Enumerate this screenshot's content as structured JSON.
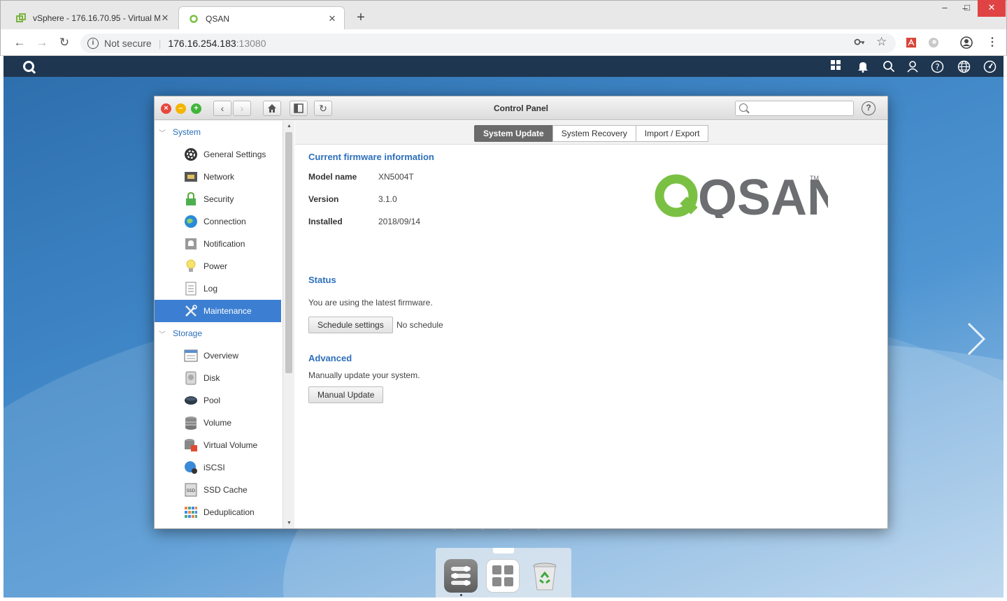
{
  "browser": {
    "tabs": [
      {
        "title": "vSphere - 176.16.70.95 - Virtual M",
        "active": false
      },
      {
        "title": "QSAN",
        "active": true
      }
    ],
    "new_tab": "+",
    "window_controls": {
      "minimize": "–",
      "maximize": "□",
      "close": "✕"
    },
    "address": {
      "security_label": "Not secure",
      "host": "176.16.254.183",
      "port": ":13080"
    },
    "icons": [
      "back-icon",
      "forward-icon",
      "reload-icon",
      "info-icon",
      "key-icon",
      "star-icon",
      "pdf-extension-icon",
      "extension-icon",
      "profile-icon",
      "menu-icon"
    ]
  },
  "topbar": {
    "icons": [
      "qsan-logo-icon",
      "apps-grid-icon",
      "bell-icon",
      "search-icon",
      "user-icon",
      "help-icon",
      "globe-icon",
      "dashboard-icon"
    ],
    "bg_color": "#1f3650"
  },
  "control_panel": {
    "title": "Control Panel",
    "search_placeholder": "",
    "help": "?",
    "sidebar": {
      "groups": [
        {
          "label": "System",
          "items": [
            {
              "label": "General Settings",
              "icon": "general-settings-icon"
            },
            {
              "label": "Network",
              "icon": "network-icon"
            },
            {
              "label": "Security",
              "icon": "lock-icon"
            },
            {
              "label": "Connection",
              "icon": "connection-globe-icon"
            },
            {
              "label": "Notification",
              "icon": "notification-bell-icon"
            },
            {
              "label": "Power",
              "icon": "lightbulb-icon"
            },
            {
              "label": "Log",
              "icon": "log-icon"
            },
            {
              "label": "Maintenance",
              "icon": "tools-icon",
              "selected": true
            }
          ]
        },
        {
          "label": "Storage",
          "items": [
            {
              "label": "Overview",
              "icon": "overview-icon"
            },
            {
              "label": "Disk",
              "icon": "disk-icon"
            },
            {
              "label": "Pool",
              "icon": "pool-icon"
            },
            {
              "label": "Volume",
              "icon": "volume-icon"
            },
            {
              "label": "Virtual Volume",
              "icon": "virtual-volume-icon"
            },
            {
              "label": "iSCSI",
              "icon": "iscsi-icon"
            },
            {
              "label": "SSD Cache",
              "icon": "ssd-icon"
            },
            {
              "label": "Deduplication",
              "icon": "deduplication-icon"
            }
          ]
        }
      ]
    },
    "tabs": [
      "System Update",
      "System Recovery",
      "Import / Export"
    ],
    "active_tab": "System Update",
    "firmware": {
      "section_title": "Current firmware information",
      "rows": [
        {
          "label": "Model name",
          "value": "XN5004T"
        },
        {
          "label": "Version",
          "value": "3.1.0"
        },
        {
          "label": "Installed",
          "value": "2018/09/14"
        }
      ]
    },
    "status": {
      "section_title": "Status",
      "message": "You are using the latest firmware.",
      "schedule_button": "Schedule settings",
      "schedule_value": "No schedule"
    },
    "advanced": {
      "section_title": "Advanced",
      "message": "Manually update your system.",
      "update_button": "Manual Update"
    },
    "logo": {
      "text": "QSAN",
      "tm": "TM",
      "green": "#7ac143",
      "gray": "#6d6e71"
    }
  },
  "dock": {
    "items": [
      "control-panel-icon",
      "apps-icon",
      "recycle-bin-icon"
    ]
  },
  "colors": {
    "accent": "#2c6fbb",
    "selected": "#3c7fd2"
  }
}
